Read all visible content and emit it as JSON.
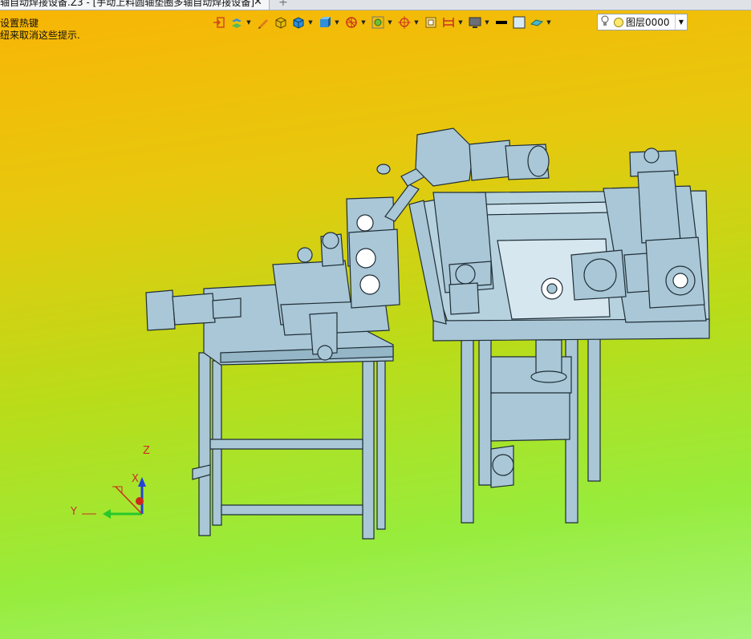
{
  "tab": {
    "title": "轴自动焊接设备.Z3 - [手动上料圆轴垫圈多轴自动焊接设备]",
    "close": "✕",
    "add": "+"
  },
  "hints": {
    "line1": "设置热键",
    "line2": "纽来取消这些提示."
  },
  "toolbar": {
    "icons": [
      "exit-icon",
      "layer-stack-icon",
      "pencil-icon",
      "box-yellow-icon",
      "box-blue-icon",
      "view-cube-icon",
      "wheel-icon",
      "zoom-fit-icon",
      "target-icon",
      "frame-icon",
      "dimension-icon",
      "monitor-icon",
      "line-color-swatch",
      "fill-color-swatch",
      "plane-icon"
    ],
    "layer_label": "图层0000"
  },
  "triad": {
    "x": "X",
    "y": "Y",
    "z": "Z"
  },
  "colors": {
    "machine": "#a9c7d6",
    "edge": "#1f2d37",
    "background_top": "#f9b404",
    "background_bottom": "#a6f47a"
  }
}
